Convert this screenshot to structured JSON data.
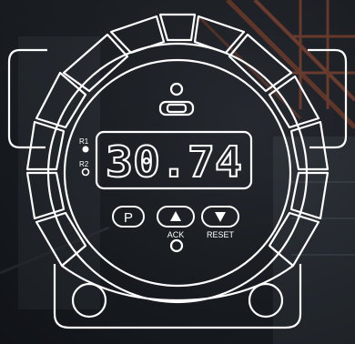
{
  "display": {
    "value": "30.74"
  },
  "indicators": {
    "r1": "R1",
    "r2": "R2"
  },
  "buttons": {
    "p_label": "P",
    "ack_label": "ACK",
    "reset_label": "RESET",
    "up_icon": "triangle-up",
    "down_icon": "triangle-down"
  },
  "colors": {
    "outline": "#ffffff",
    "background": "#1b1f24",
    "accent": "#c0502a"
  }
}
